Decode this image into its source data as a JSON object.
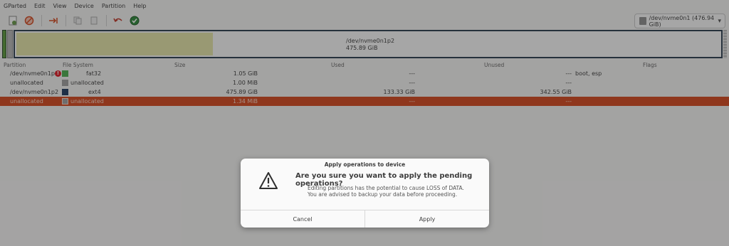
{
  "menu": [
    "GParted",
    "Edit",
    "View",
    "Device",
    "Partition",
    "Help"
  ],
  "device_select": {
    "value": "/dev/nvme0n1 (476.94 GiB)"
  },
  "disk_map": {
    "label_name": "/dev/nvme0n1p2",
    "label_size": "475.89 GiB"
  },
  "table": {
    "headers": [
      "Partition",
      "File System",
      "Size",
      "Used",
      "Unused",
      "Flags"
    ],
    "rows": [
      {
        "partition": "/dev/nvme0n1p1",
        "fs": "fat32",
        "size": "1.05 GiB",
        "used": "---",
        "unused": "---",
        "flags": "boot, esp",
        "color": "#4caf50",
        "warn": true
      },
      {
        "partition": "unallocated",
        "fs": "unallocated",
        "size": "1.00 MiB",
        "used": "---",
        "unused": "---",
        "flags": "",
        "color": "#a0a0a0",
        "warn": false
      },
      {
        "partition": "/dev/nvme0n1p2",
        "fs": "ext4",
        "size": "475.89 GiB",
        "used": "133.33 GiB",
        "unused": "342.55 GiB",
        "flags": "",
        "color": "#1f3a5f",
        "warn": false
      },
      {
        "partition": "unallocated",
        "fs": "unallocated",
        "size": "1.34 MiB",
        "used": "---",
        "unused": "---",
        "flags": "",
        "color": "#a0a0a0",
        "warn": false
      }
    ]
  },
  "dialog": {
    "title": "Apply operations to device",
    "heading": "Are you sure you want to apply the pending operations?",
    "body_line1": "Editing partitions has the potential to cause LOSS of DATA.",
    "body_line2": "You are advised to backup your data before proceeding.",
    "cancel_label": "Cancel",
    "apply_label": "Apply"
  },
  "colors": {
    "selection": "#d5481d",
    "used_fill": "#e6e6a8"
  }
}
